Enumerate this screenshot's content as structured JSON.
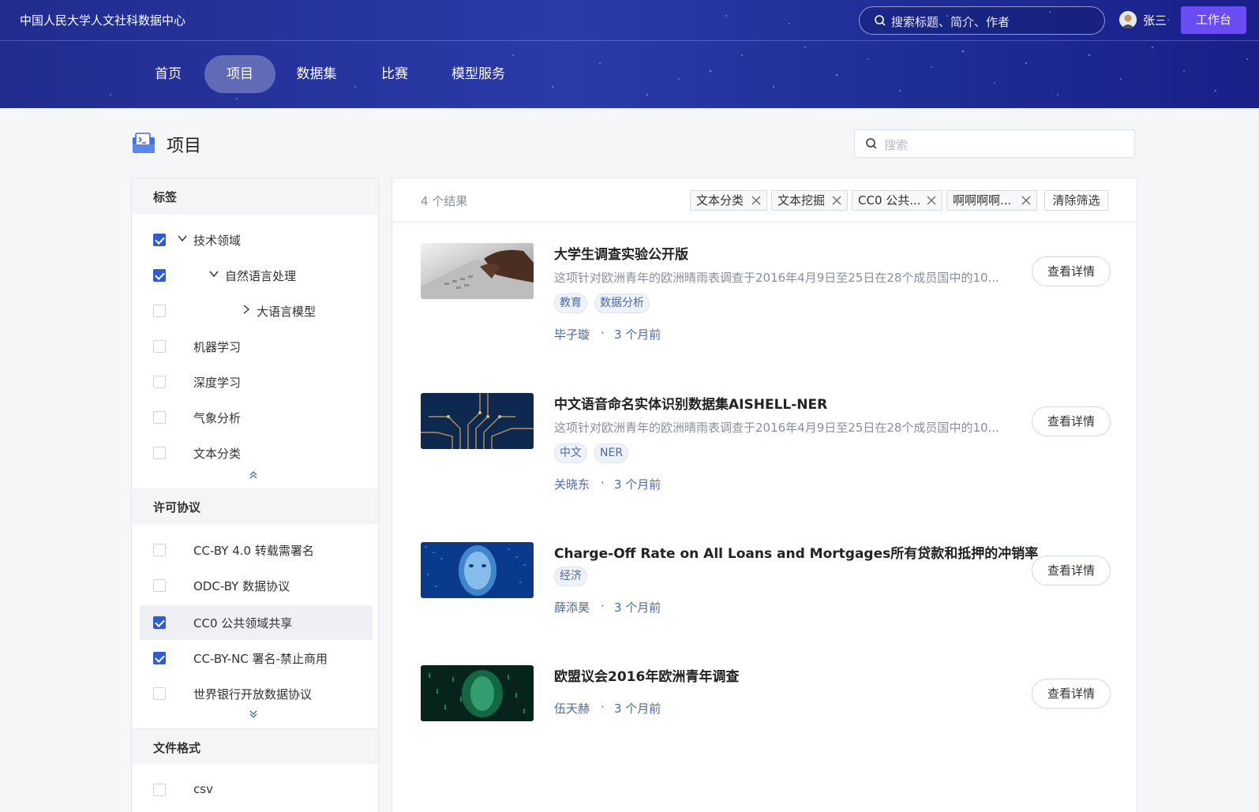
{
  "header": {
    "site_title": "中国人民大学人文社科数据中心",
    "search_placeholder": "搜索标题、简介、作者",
    "user_name": "张三",
    "workbench_label": "工作台",
    "nav": [
      "首页",
      "项目",
      "数据集",
      "比赛",
      "模型服务"
    ],
    "active_nav": "项目"
  },
  "page": {
    "title": "项目",
    "search_placeholder": "搜索"
  },
  "sidebar": {
    "tags": {
      "heading": "标签",
      "items": [
        {
          "label": "技术领域",
          "checked": true,
          "expander": "expanded"
        },
        {
          "label": "自然语言处理",
          "checked": true,
          "expander": "expanded"
        },
        {
          "label": "大语言模型",
          "checked": false,
          "expander": "collapsed"
        },
        {
          "label": "机器学习",
          "checked": false
        },
        {
          "label": "深度学习",
          "checked": false
        },
        {
          "label": "气象分析",
          "checked": false
        },
        {
          "label": "文本分类",
          "checked": false
        }
      ]
    },
    "licenses": {
      "heading": "许可协议",
      "items": [
        {
          "label": "CC-BY 4.0 转载需署名",
          "checked": false
        },
        {
          "label": "ODC-BY 数据协议",
          "checked": false
        },
        {
          "label": "CC0 公共领域共享",
          "checked": true
        },
        {
          "label": "CC-BY-NC 署名-禁止商用",
          "checked": true
        },
        {
          "label": "世界银行开放数据协议",
          "checked": false
        }
      ]
    },
    "formats": {
      "heading": "文件格式",
      "items": [
        {
          "label": "csv",
          "checked": false
        }
      ]
    }
  },
  "results": {
    "count_text": "4 个结果",
    "filters": [
      "文本分类",
      "文本挖掘",
      "CC0 公共...",
      "啊啊啊啊..."
    ],
    "clear_label": "清除筛选",
    "detail_label": "查看详情",
    "items": [
      {
        "title": "大学生调查实验公开版",
        "desc": "这项针对欧洲青年的欧洲晴雨表调查于2016年4月9日至25日在28个成员国中的10...",
        "tags": [
          "教育",
          "数据分析"
        ],
        "author": "毕子璇",
        "time": "3 个月前",
        "thumb": "laptop-typing"
      },
      {
        "title": "中文语音命名实体识别数据集AISHELL-NER",
        "desc": "这项针对欧洲青年的欧洲晴雨表调查于2016年4月9日至25日在28个成员国中的10...",
        "tags": [
          "中文",
          "NER"
        ],
        "author": "关晓东",
        "time": "3 个月前",
        "thumb": "circuit-board"
      },
      {
        "title": "Charge-Off Rate on All Loans and Mortgages所有贷款和抵押的冲销率",
        "desc": "",
        "tags": [
          "经济"
        ],
        "author": "薛添昊",
        "time": "3 个月前",
        "thumb": "digital-face"
      },
      {
        "title": "欧盟议会2016年欧洲青年调查",
        "desc": "",
        "tags": [],
        "author": "伍天赫",
        "time": "3 个月前",
        "thumb": "green-data"
      }
    ]
  },
  "colors": {
    "accent": "#2f5bd3",
    "workbench": "#6a4cf5",
    "header_start": "#222c8f",
    "header_end": "#1a1f8a",
    "meta": "#4d6aa8"
  }
}
